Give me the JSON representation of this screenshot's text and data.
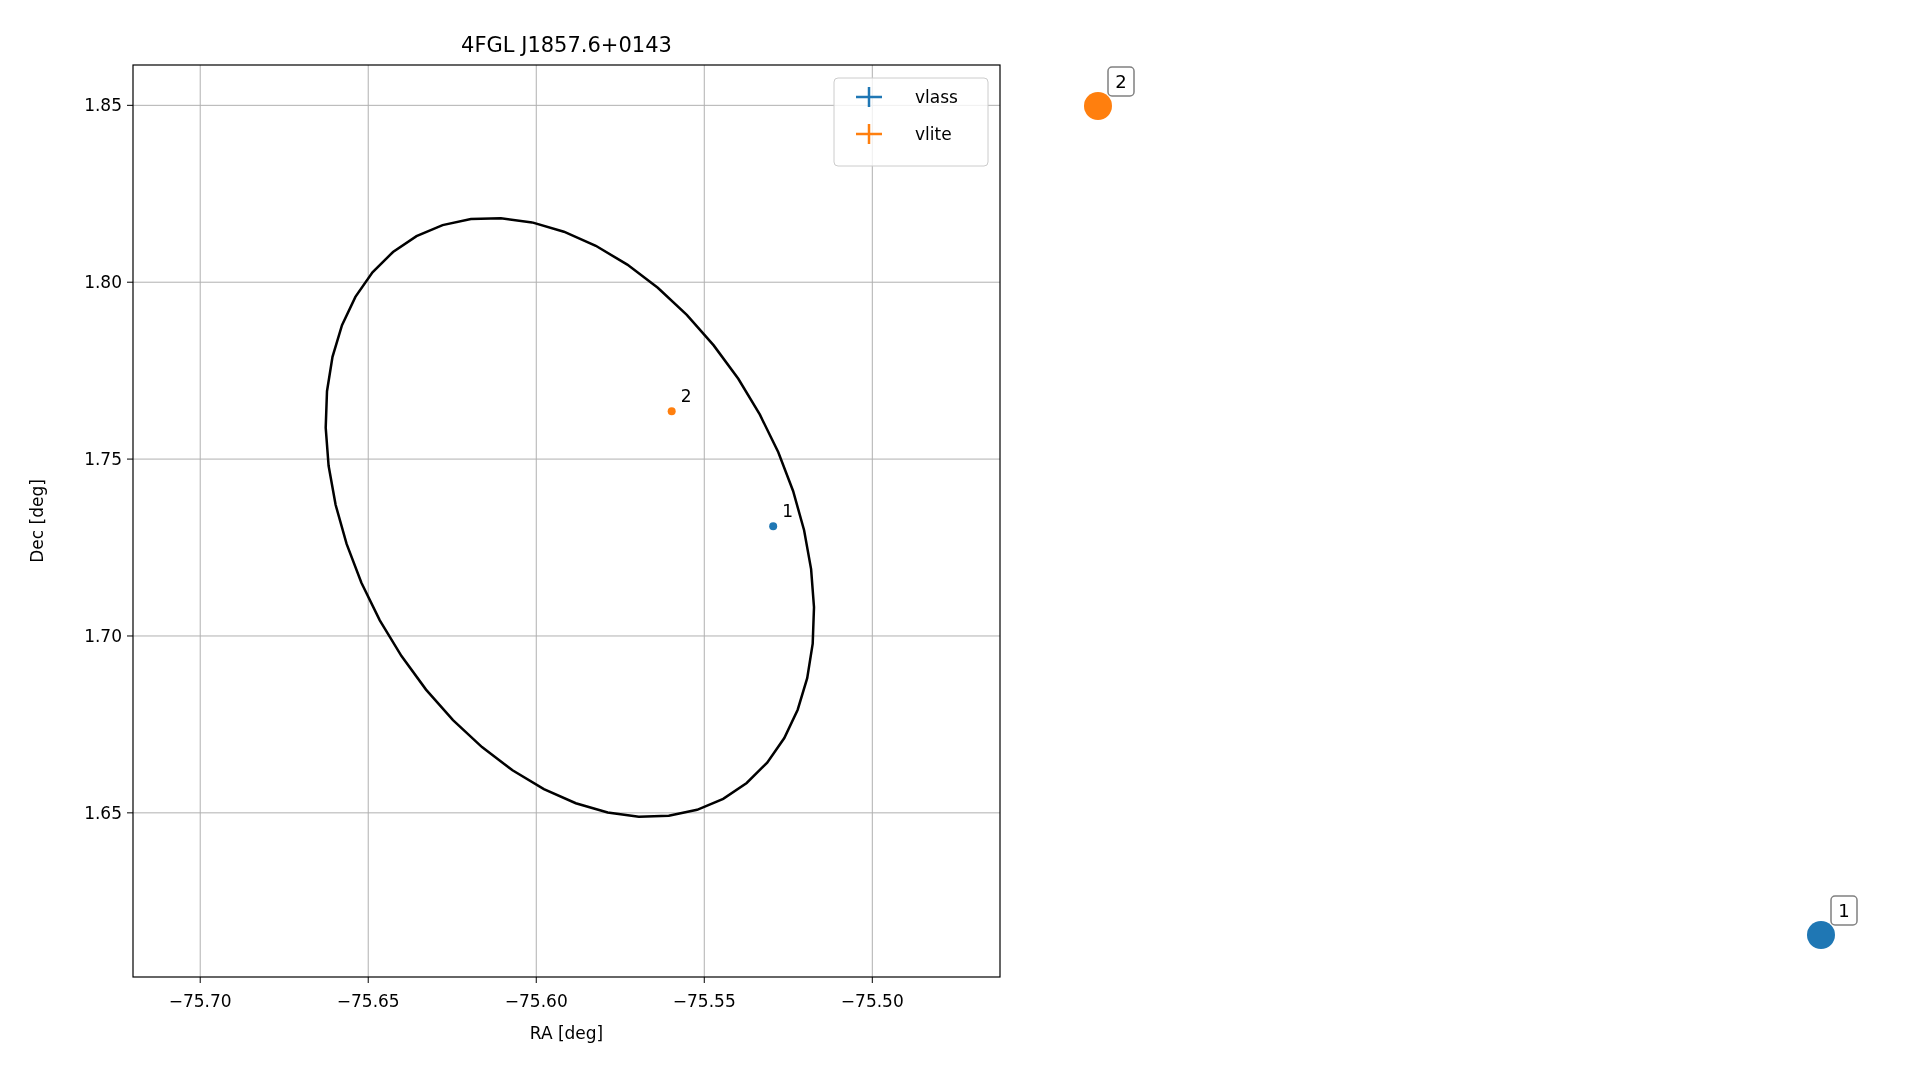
{
  "figure": {
    "chart_data": {
      "type": "scatter",
      "title": "4FGL J1857.6+0143",
      "xlabel": "RA [deg]",
      "ylabel": "Dec [deg]",
      "xlim": [
        -75.72,
        -75.462
      ],
      "ylim": [
        1.6036,
        1.8614
      ],
      "grid": true,
      "legend": "upper right",
      "xticks": [
        {
          "value": -75.7,
          "label": "−75.70"
        },
        {
          "value": -75.65,
          "label": "−75.65"
        },
        {
          "value": -75.6,
          "label": "−75.60"
        },
        {
          "value": -75.55,
          "label": "−75.55"
        },
        {
          "value": -75.5,
          "label": "−75.50"
        }
      ],
      "yticks": [
        {
          "value": 1.65,
          "label": "1.65"
        },
        {
          "value": 1.7,
          "label": "1.70"
        },
        {
          "value": 1.75,
          "label": "1.75"
        },
        {
          "value": 1.8,
          "label": "1.80"
        },
        {
          "value": 1.85,
          "label": "1.85"
        }
      ],
      "series": [
        {
          "name": "vlass",
          "color": "#1f77b4",
          "x": [
            -75.5295
          ],
          "values": [
            1.731
          ]
        },
        {
          "name": "vlite",
          "color": "#ff7f0e",
          "x": [
            -75.5597
          ],
          "values": [
            1.7635
          ]
        }
      ],
      "annotations": [
        {
          "text": "1",
          "x": -75.5295,
          "y": 1.731
        },
        {
          "text": "2",
          "x": -75.5597,
          "y": 1.7635
        }
      ]
    },
    "offaxis_markers": [
      {
        "label": "2",
        "color": "#ff7f0e"
      },
      {
        "label": "1",
        "color": "#1f77b4"
      }
    ]
  }
}
